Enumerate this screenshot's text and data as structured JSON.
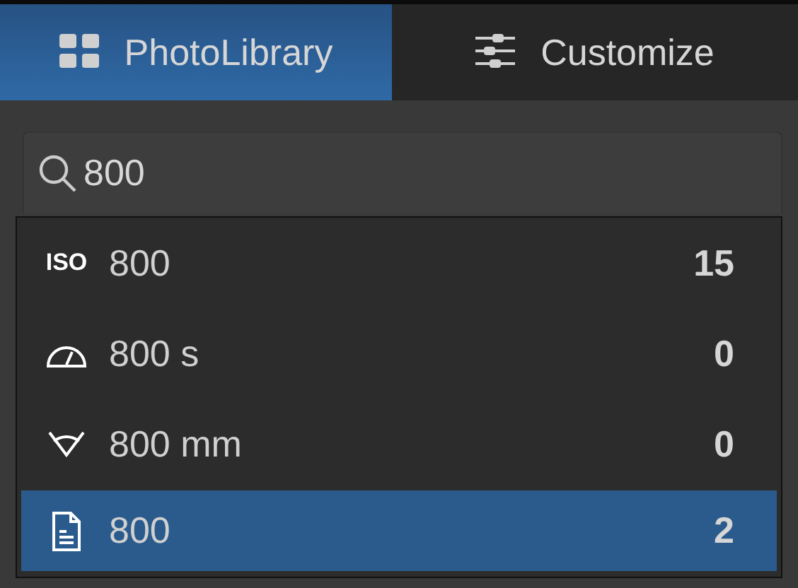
{
  "tabs": [
    {
      "label": "PhotoLibrary",
      "kind": "grid",
      "selected": true
    },
    {
      "label": "Customize",
      "kind": "sliders",
      "selected": false
    }
  ],
  "search": {
    "value": "800"
  },
  "suggestions": [
    {
      "kind": "iso",
      "icon_text": "ISO",
      "label": "800",
      "count": "15",
      "selected": false
    },
    {
      "kind": "speed",
      "label": "800 s",
      "count": "0",
      "selected": false
    },
    {
      "kind": "focal",
      "label": "800 mm",
      "count": "0",
      "selected": false
    },
    {
      "kind": "document",
      "label": "800",
      "count": "2",
      "selected": true
    }
  ]
}
